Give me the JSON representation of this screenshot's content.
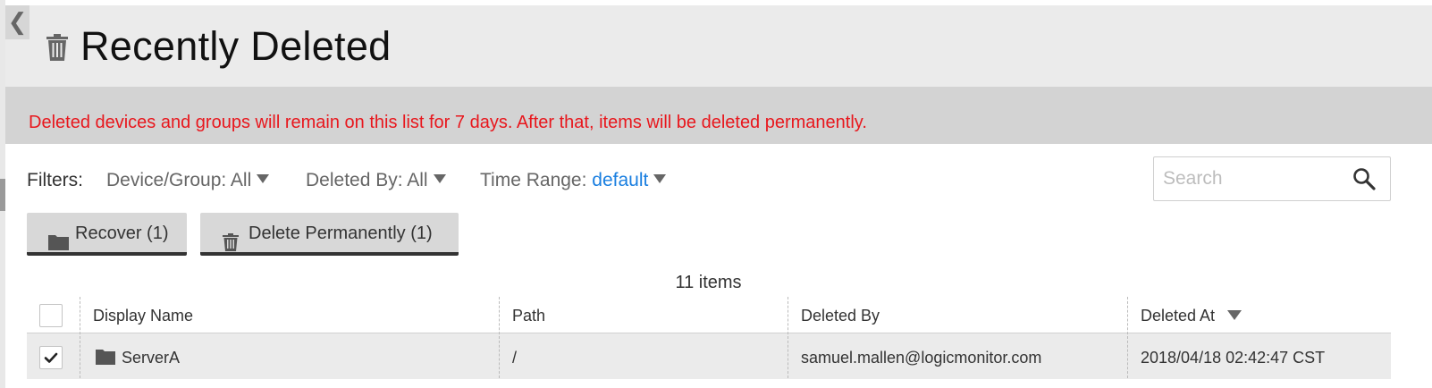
{
  "header": {
    "title": "Recently Deleted",
    "title_icon": "trash-icon",
    "collapse_icon": "chevron-left-icon",
    "collapse_glyph": "❮"
  },
  "banner": {
    "message": "Deleted devices and groups will remain on this list for 7 days. After that, items will be deleted permanently."
  },
  "filters": {
    "label": "Filters:",
    "device_group": {
      "label": "Device/Group:",
      "value": "All"
    },
    "deleted_by": {
      "label": "Deleted By:",
      "value": "All"
    },
    "time_range": {
      "label": "Time Range:",
      "value": "default"
    }
  },
  "search": {
    "placeholder": "Search",
    "value": ""
  },
  "actions": {
    "recover_label": "Recover (1)",
    "delete_label": "Delete Permanently (1)"
  },
  "table": {
    "count_text": "11 items",
    "columns": [
      "Display Name",
      "Path",
      "Deleted By",
      "Deleted At"
    ],
    "sorted_column": "Deleted At",
    "rows": [
      {
        "checked": true,
        "icon": "folder-icon",
        "display_name": "ServerA",
        "path": "/",
        "deleted_by": "samuel.mallen@logicmonitor.com",
        "deleted_at": "2018/04/18 02:42:47 CST"
      }
    ]
  },
  "colors": {
    "banner_text": "#e8171d",
    "link": "#1a7fe0",
    "header_bg": "#ebebeb",
    "banner_bg": "#d3d3d3"
  }
}
